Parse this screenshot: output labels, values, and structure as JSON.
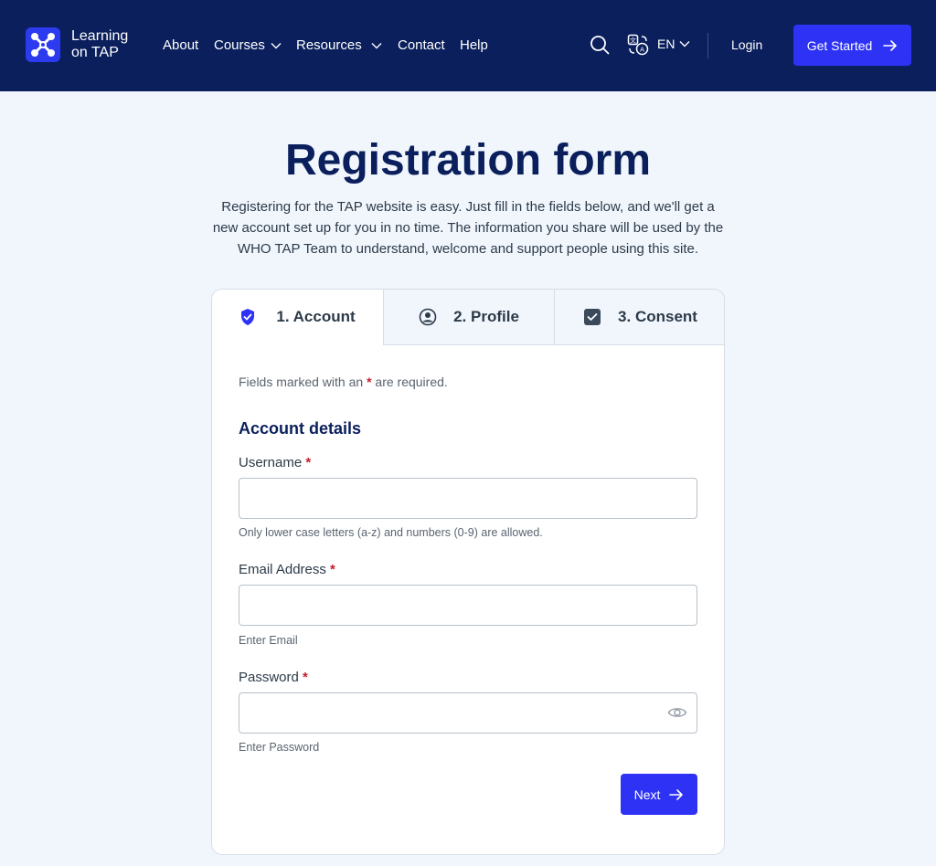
{
  "header": {
    "brand_line1": "Learning",
    "brand_line2": "on TAP",
    "nav": {
      "about": "About",
      "courses": "Courses",
      "resources": "Resources",
      "contact": "Contact",
      "help": "Help"
    },
    "language": "EN",
    "login": "Login",
    "cta": "Get Started",
    "colors": {
      "bar": "#0a1f5c",
      "accent": "#2e32f5"
    }
  },
  "page": {
    "title": "Registration form",
    "intro": "Registering for the TAP website is easy. Just fill in the fields below, and we'll get a new account set up for you in no time. The information you share will be used by the WHO TAP Team to understand, welcome and support people using this site."
  },
  "tabs": [
    {
      "label": "1. Account",
      "icon": "shield-check-icon",
      "active": true
    },
    {
      "label": "2. Profile",
      "icon": "user-circle-icon",
      "active": false
    },
    {
      "label": "3. Consent",
      "icon": "checkbox-icon",
      "active": false
    }
  ],
  "form": {
    "required_prefix": "Fields marked with an",
    "required_star": "*",
    "required_suffix": "are required.",
    "section_title": "Account details",
    "username": {
      "label": "Username",
      "star": "*",
      "value": "",
      "hint": "Only lower case letters (a-z) and numbers (0-9) are allowed."
    },
    "email": {
      "label": "Email Address",
      "star": "*",
      "value": "",
      "hint": "Enter Email"
    },
    "password": {
      "label": "Password",
      "star": "*",
      "value": "",
      "hint": "Enter Password"
    },
    "next": "Next"
  }
}
